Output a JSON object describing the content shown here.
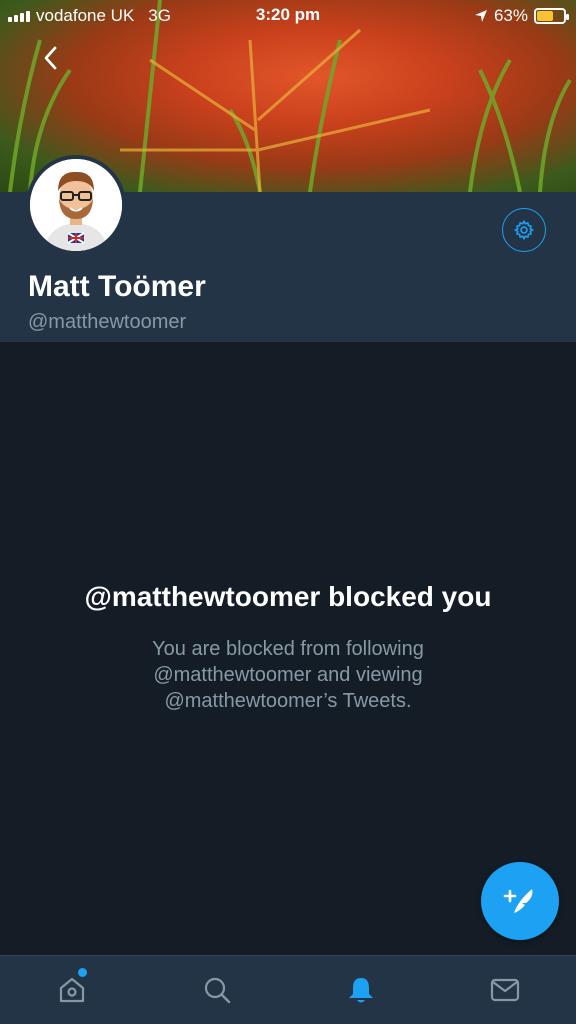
{
  "status_bar": {
    "carrier": "vodafone UK",
    "network": "3G",
    "time": "3:20 pm",
    "battery_percent": "63%",
    "battery_level": 0.63
  },
  "profile": {
    "display_name": "Matt Toömer",
    "handle": "@matthewtoomer"
  },
  "blocked": {
    "title": "@matthewtoomer blocked you",
    "line1": "You are blocked from following",
    "line2": "@matthewtoomer and viewing",
    "line3": "@matthewtoomer’s Tweets."
  },
  "icons": {
    "back": "chevron-left-icon",
    "settings": "gear-icon",
    "compose": "compose-tweet-icon",
    "home": "home-icon",
    "search": "search-icon",
    "notifications": "bell-icon",
    "messages": "envelope-icon"
  },
  "colors": {
    "accent": "#1da1f2",
    "background": "#141d26",
    "header_background": "#243447",
    "secondary_text": "#8899a6",
    "battery": "#f7c331"
  }
}
